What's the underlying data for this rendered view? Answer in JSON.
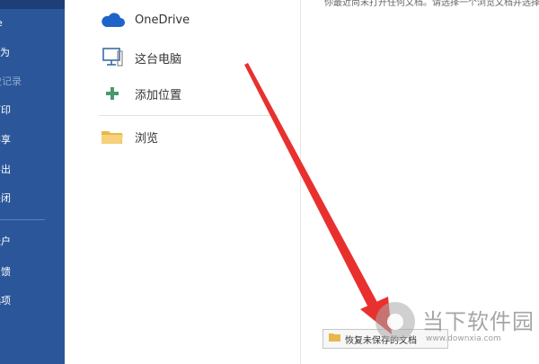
{
  "sidebar": {
    "items": [
      {
        "label": "e"
      },
      {
        "label": "另存为"
      },
      {
        "label": "历史记录"
      },
      {
        "label": "打印"
      },
      {
        "label": "共享"
      },
      {
        "label": "导出"
      },
      {
        "label": "关闭"
      },
      {
        "label": "账户"
      },
      {
        "label": "反馈"
      },
      {
        "label": "选项"
      }
    ]
  },
  "places": [
    {
      "label": "OneDrive",
      "icon": "cloud-icon"
    },
    {
      "label": "这台电脑",
      "icon": "computer-icon"
    },
    {
      "label": "添加位置",
      "icon": "plus-icon"
    },
    {
      "label": "浏览",
      "icon": "folder-icon"
    }
  ],
  "main": {
    "hint": "你最近尚未打开任何文档。请选择一个浏览文档并选择位置。",
    "recover_button": "恢复未保存的文档"
  },
  "watermark": {
    "brand": "当下软件园",
    "url": "www.downxia.com"
  },
  "colors": {
    "sidebar": "#2b579a",
    "arrow": "#e8312f",
    "onedrive": "#1e64c8",
    "plus": "#4a9a6a",
    "folder": "#f2c766"
  }
}
